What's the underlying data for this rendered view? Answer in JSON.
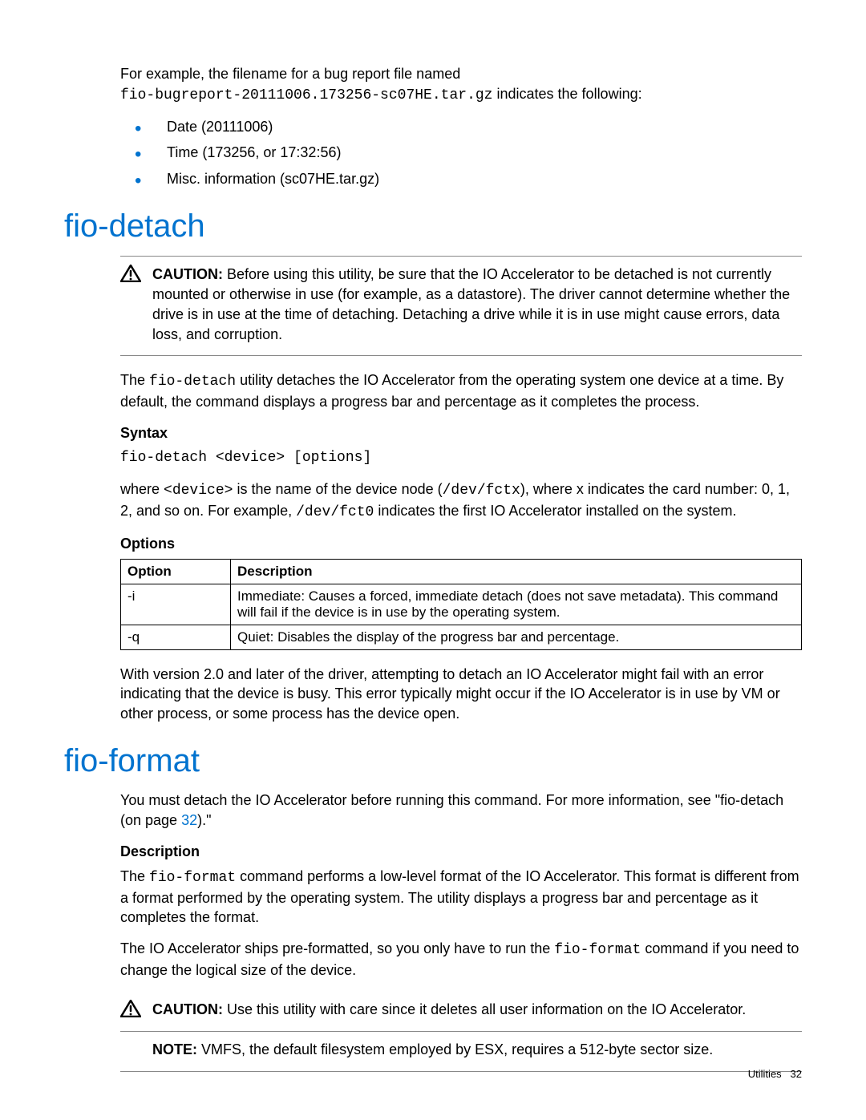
{
  "intro": {
    "line1": "For example, the filename for a bug report file named",
    "code": "fio-bugreport-20111006.173256-sc07HE.tar.gz",
    "line2": " indicates the following:",
    "bullets": [
      "Date (20111006)",
      "Time (173256, or 17:32:56)",
      "Misc. information (sc07HE.tar.gz)"
    ]
  },
  "detach": {
    "heading": "fio-detach",
    "caution_label": "CAUTION:",
    "caution_text": "   Before using this utility, be sure that the IO Accelerator to be detached is not currently mounted or otherwise in use (for example, as a datastore). The driver cannot determine whether the drive is in use at the time of detaching. Detaching a drive while it is in use might cause errors, data loss, and corruption.",
    "para1_a": "The ",
    "para1_code": "fio-detach",
    "para1_b": " utility detaches the IO Accelerator from the operating system one device at a time. By default, the command displays a progress bar and percentage as it completes the process.",
    "syntax_label": "Syntax",
    "syntax_code": "fio-detach <device> [options]",
    "where_a": "where ",
    "where_code1": "<device>",
    "where_b": " is the name of the device node (",
    "where_code2": "/dev/fctx",
    "where_c": "), where x indicates the card number: 0, 1, 2, and so on. For example, ",
    "where_code3": "/dev/fct0",
    "where_d": " indicates the first IO Accelerator installed on the system.",
    "options_label": "Options",
    "table": {
      "h1": "Option",
      "h2": "Description",
      "rows": [
        {
          "opt": "-i",
          "desc": "Immediate: Causes a forced, immediate detach (does not save metadata). This command will fail if the device is in use by the operating system."
        },
        {
          "opt": "-q",
          "desc": "Quiet: Disables the display of the progress bar and percentage."
        }
      ]
    },
    "busy": "With version 2.0 and later of the driver, attempting to detach an IO Accelerator might fail with an error indicating that the device is busy. This error typically might occur if the IO Accelerator is in use by VM or other process, or some process has the device open."
  },
  "format": {
    "heading": "fio-format",
    "must_a": "You must detach the IO Accelerator before running this command. For more information, see \"fio-detach (on page ",
    "must_link": "32",
    "must_b": ").\"",
    "desc_label": "Description",
    "desc_a": "The ",
    "desc_code": "fio-format",
    "desc_b": " command performs a low-level format of the IO Accelerator. This format is different from a format performed by the operating system. The utility displays a progress bar and percentage as it completes the format.",
    "pre_a": "The IO Accelerator ships pre-formatted, so you only have to run the ",
    "pre_code": "fio-format",
    "pre_b": " command if you need to change the logical size of the device.",
    "caution_label": "CAUTION:",
    "caution_text": "   Use this utility with care since it deletes all user information on the IO Accelerator.",
    "note_label": "NOTE:",
    "note_text": "  VMFS, the default filesystem employed by ESX, requires a 512-byte sector size."
  },
  "footer": {
    "section": "Utilities",
    "page": "32"
  }
}
